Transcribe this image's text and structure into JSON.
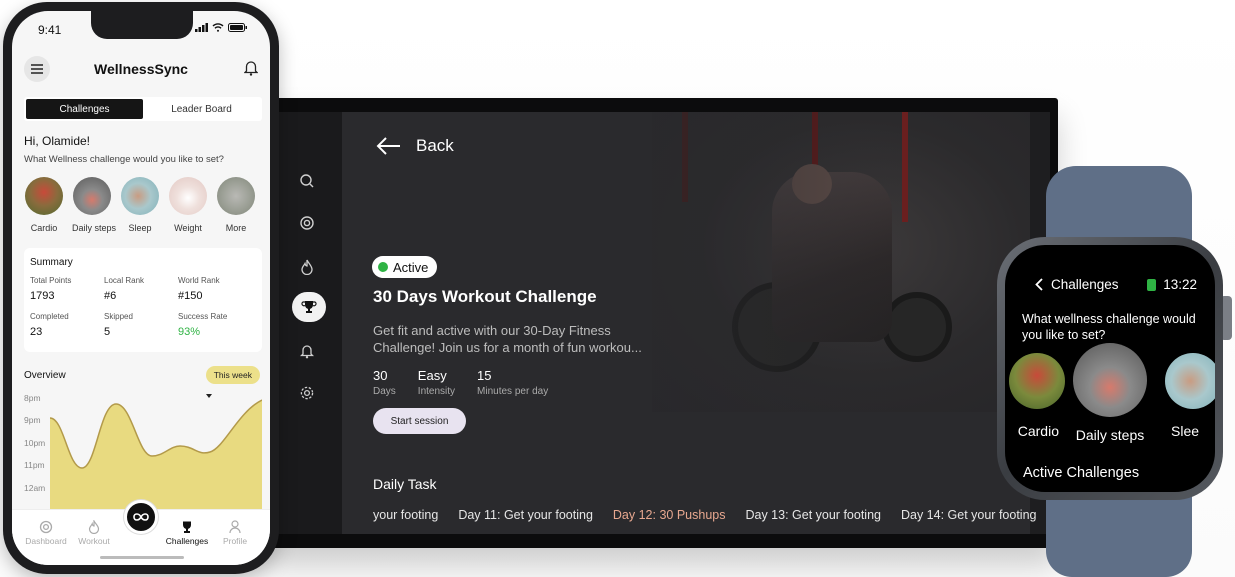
{
  "phone": {
    "status_time": "9:41",
    "app_title": "WellnessSync",
    "segment": [
      "Challenges",
      "Leader Board"
    ],
    "greeting": "Hi, Olamide!",
    "question": "What Wellness challenge would you like to set?",
    "categories": [
      "Cardio",
      "Daily steps",
      "Sleep",
      "Weight",
      "More"
    ],
    "summary": {
      "title": "Summary",
      "items": [
        {
          "label": "Total Points",
          "value": "1793"
        },
        {
          "label": "Local Rank",
          "value": "#6"
        },
        {
          "label": "World Rank",
          "value": "#150"
        },
        {
          "label": "Completed",
          "value": "23"
        },
        {
          "label": "Skipped",
          "value": "5"
        },
        {
          "label": "Success Rate",
          "value": "93%"
        }
      ]
    },
    "overview": {
      "title": "Overview",
      "filter": "This week",
      "y_labels": [
        "8pm",
        "9pm",
        "10pm",
        "11pm",
        "12am"
      ]
    },
    "tabs": [
      "Dashboard",
      "Workout",
      "Challenges",
      "Profile"
    ]
  },
  "tv": {
    "back_label": "Back",
    "status": "Active",
    "title": "30 Days Workout Challenge",
    "description": "Get fit and active with our 30-Day Fitness Challenge! Join us for a month of fun workou...",
    "stats": [
      {
        "value": "30",
        "label": "Days"
      },
      {
        "value": "Easy",
        "label": "Intensity"
      },
      {
        "value": "15",
        "label": "Minutes per day"
      }
    ],
    "start_button": "Start session",
    "daily_title": "Daily Task",
    "daily_tasks": [
      "your footing",
      "Day 11: Get your footing",
      "Day 12: 30 Pushups",
      "Day 13: Get your footing",
      "Day 14: Get your footing"
    ]
  },
  "watch": {
    "back_label": "Challenges",
    "time": "13:22",
    "question": "What wellness challenge would you like to set?",
    "categories": [
      "Cardio",
      "Daily steps",
      "Slee"
    ],
    "section": "Active Challenges"
  }
}
